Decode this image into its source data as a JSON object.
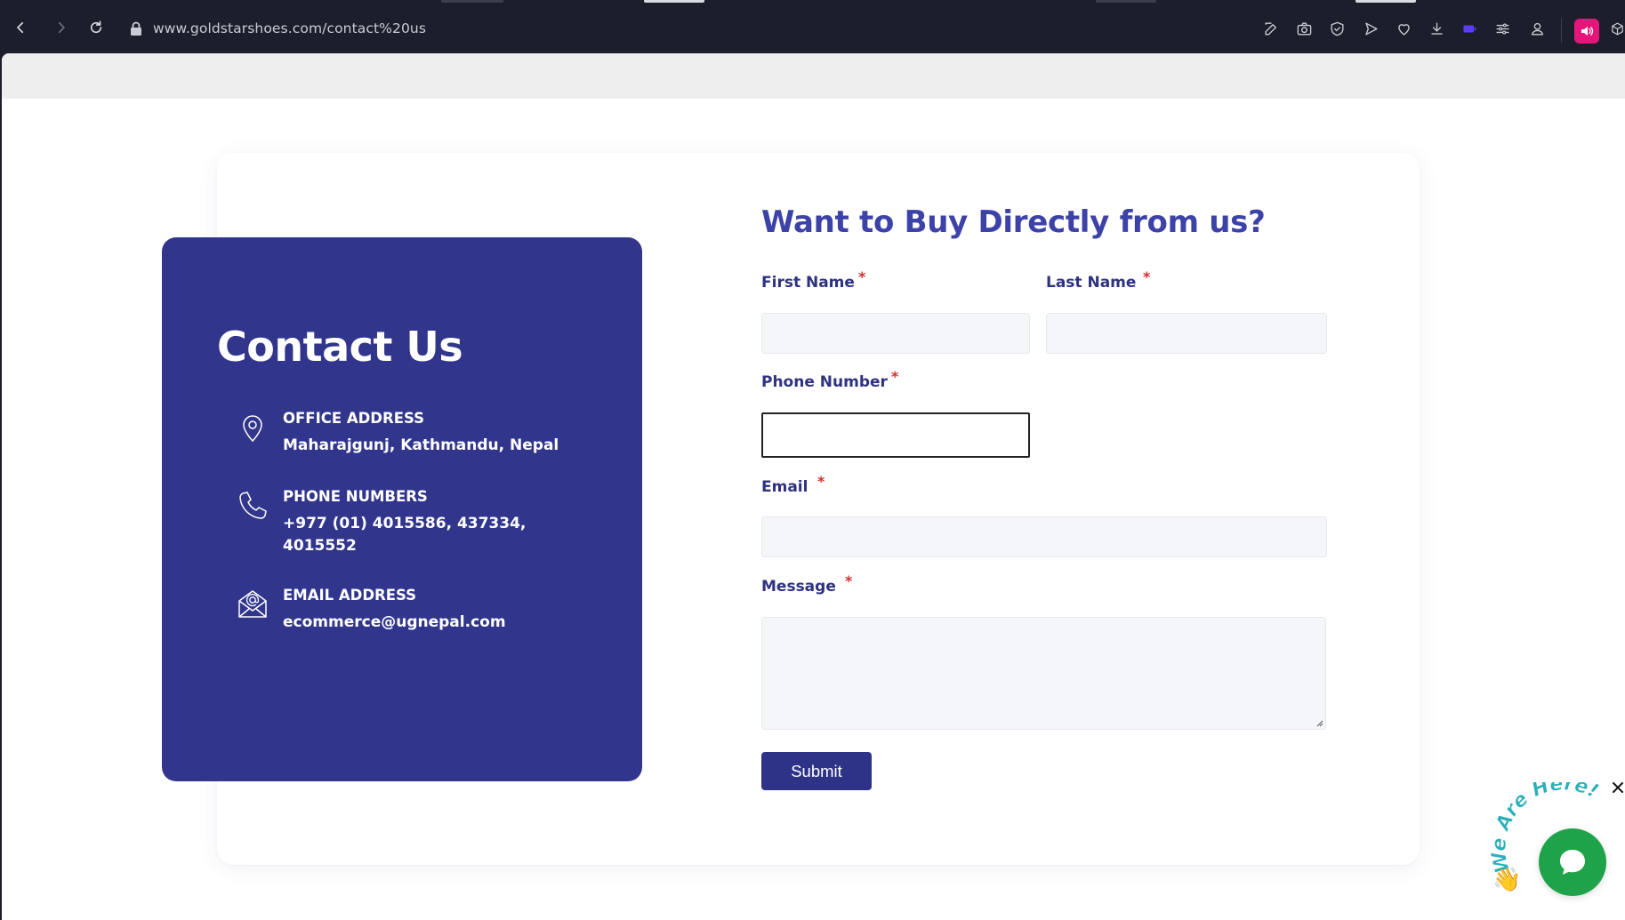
{
  "browser": {
    "url": "www.goldstarshoes.com/contact%20us"
  },
  "contact": {
    "title": "Contact Us",
    "office_label": "OFFICE ADDRESS",
    "office_value": "Maharajgunj, Kathmandu, Nepal",
    "phone_label": "PHONE NUMBERS",
    "phone_value": "+977 (01) 4015586, 437334, 4015552",
    "email_label": "EMAIL ADDRESS",
    "email_value": "ecommerce@ugnepal.com"
  },
  "form": {
    "title": "Want to Buy Directly from us?",
    "first_name_label": "First Name",
    "last_name_label": "Last Name",
    "phone_label": "Phone Number",
    "email_label": "Email",
    "message_label": "Message",
    "required_mark": "*",
    "submit_label": "Submit"
  },
  "chat": {
    "badge_text": "We Are Here!",
    "emoji": "👋"
  },
  "colors": {
    "primary": "#31368c",
    "title": "#3d42a8",
    "required": "#d43030",
    "chat_green": "#1fa34a"
  }
}
